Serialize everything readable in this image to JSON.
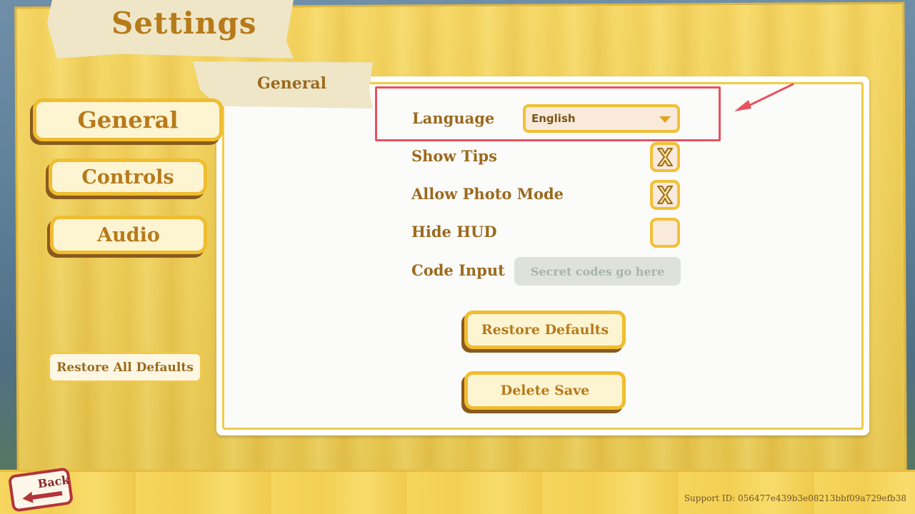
{
  "header": {
    "title": "Settings"
  },
  "tab": {
    "active_label": "General"
  },
  "sidebar": {
    "items": [
      {
        "label": "General",
        "active": true
      },
      {
        "label": "Controls",
        "active": false
      },
      {
        "label": "Audio",
        "active": false
      }
    ],
    "restore_all_label": "Restore All Defaults"
  },
  "settings": {
    "language": {
      "label": "Language",
      "value": "English"
    },
    "show_tips": {
      "label": "Show Tips",
      "checked": true
    },
    "allow_photo_mode": {
      "label": "Allow Photo Mode",
      "checked": true
    },
    "hide_hud": {
      "label": "Hide HUD",
      "checked": false
    },
    "code_input": {
      "label": "Code Input",
      "value": "",
      "placeholder": "Secret codes go here"
    }
  },
  "actions": {
    "restore_defaults_label": "Restore Defaults",
    "delete_save_label": "Delete Save"
  },
  "footer": {
    "back_label": "Back",
    "support_text": "Support ID: 056477e439b3e08213bbf09a729efb38"
  },
  "colors": {
    "accent_yellow": "#f0bd2f",
    "text_brown": "#9b6a1e",
    "highlight_red": "#e8525e",
    "back_red": "#b3343a"
  },
  "icons": {
    "checkbox_mark": "x-mark-icon",
    "dropdown": "triangle-down-icon",
    "back": "arrow-left-icon"
  }
}
